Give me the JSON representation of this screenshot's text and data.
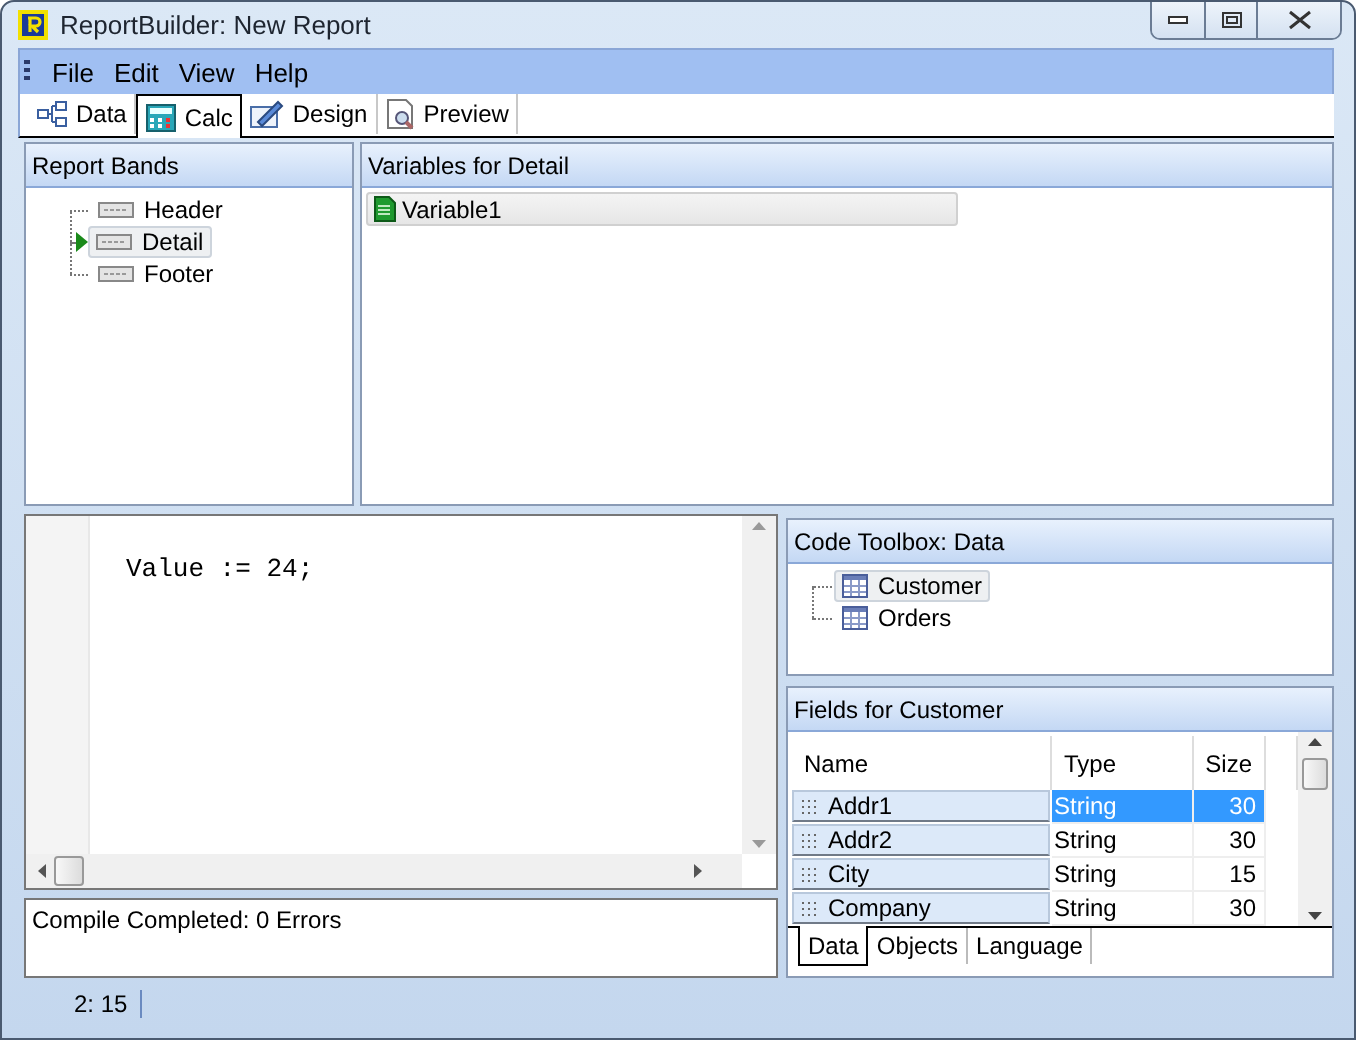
{
  "window": {
    "title": "ReportBuilder: New Report"
  },
  "menu": [
    "File",
    "Edit",
    "View",
    "Help"
  ],
  "tabs": [
    {
      "label": "Data",
      "kind": "data",
      "selected": false
    },
    {
      "label": "Calc",
      "kind": "calc",
      "selected": true
    },
    {
      "label": "Design",
      "kind": "design",
      "selected": false
    },
    {
      "label": "Preview",
      "kind": "preview",
      "selected": false
    }
  ],
  "report_bands": {
    "title": "Report Bands",
    "items": [
      {
        "label": "Header",
        "selected": false
      },
      {
        "label": "Detail",
        "selected": true
      },
      {
        "label": "Footer",
        "selected": false
      }
    ]
  },
  "variables": {
    "title": "Variables for Detail",
    "items": [
      {
        "label": "Variable1"
      }
    ]
  },
  "code_editor": {
    "lines": [
      "Value := 24;"
    ]
  },
  "message": "Compile Completed: 0 Errors",
  "code_toolbox": {
    "title": "Code Toolbox: Data",
    "items": [
      {
        "label": "Customer",
        "selected": true
      },
      {
        "label": "Orders",
        "selected": false
      }
    ]
  },
  "fields": {
    "title": "Fields for Customer",
    "columns": [
      "Name",
      "Type",
      "Size"
    ],
    "rows": [
      {
        "name": "Addr1",
        "type": "String",
        "size": "30",
        "selected": true
      },
      {
        "name": "Addr2",
        "type": "String",
        "size": "30",
        "selected": false
      },
      {
        "name": "City",
        "type": "String",
        "size": "15",
        "selected": false
      },
      {
        "name": "Company",
        "type": "String",
        "size": "30",
        "selected": false
      }
    ]
  },
  "toolbox_tabs": [
    {
      "label": "Data",
      "selected": true
    },
    {
      "label": "Objects",
      "selected": false
    },
    {
      "label": "Language",
      "selected": false
    }
  ],
  "status_bar": {
    "position": "2: 15"
  }
}
